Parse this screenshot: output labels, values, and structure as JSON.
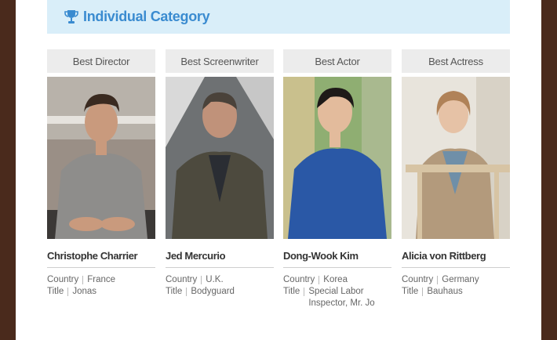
{
  "section": {
    "title": "Individual Category",
    "icon": "trophy-icon",
    "accent": "#3a8bd0"
  },
  "labels": {
    "country": "Country",
    "title": "Title"
  },
  "awards": [
    {
      "category": "Best Director",
      "name": "Christophe Charrier",
      "country": "France",
      "title": "Jonas"
    },
    {
      "category": "Best Screenwriter",
      "name": "Jed Mercurio",
      "country": "U.K.",
      "title": "Bodyguard"
    },
    {
      "category": "Best Actor",
      "name": "Dong-Wook Kim",
      "country": "Korea",
      "title": "Special Labor Inspector, Mr. Jo"
    },
    {
      "category": "Best Actress",
      "name": "Alicia von Rittberg",
      "country": "Germany",
      "title": "Bauhaus"
    }
  ]
}
